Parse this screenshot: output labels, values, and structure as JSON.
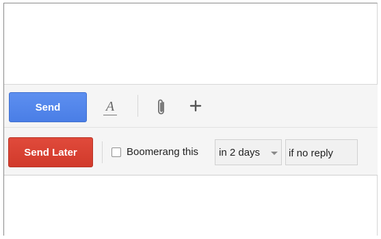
{
  "compose_toolbar": {
    "send_label": "Send",
    "formatting_icon": "text-formatting-icon",
    "attach_icon": "paperclip-icon",
    "more_icon": "plus-icon"
  },
  "boomerang_bar": {
    "send_later_label": "Send Later",
    "boomerang_label": "Boomerang this",
    "boomerang_checked": false,
    "delay_value": "in 2 days",
    "condition_value": "if no reply"
  },
  "colors": {
    "send_button": "#4a7ee6",
    "send_later_button": "#d13a2b",
    "toolbar_background": "#f5f5f5"
  }
}
